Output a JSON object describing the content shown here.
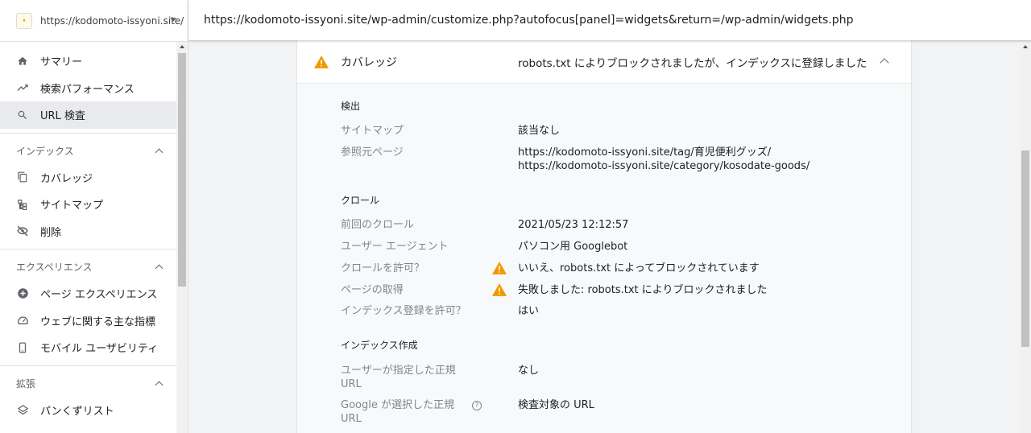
{
  "property": {
    "name": "https://kodomoto-issyoni.site/",
    "icon": "site-favicon"
  },
  "url_bar": {
    "value": "https://kodomoto-issyoni.site/wp-admin/customize.php?autofocus[panel]=widgets&return=/wp-admin/widgets.php"
  },
  "sidebar": {
    "top_items": [
      {
        "label": "サマリー",
        "icon": "home-icon"
      },
      {
        "label": "検索パフォーマンス",
        "icon": "trending-icon"
      },
      {
        "label": "URL 検査",
        "icon": "search-icon",
        "active": true
      }
    ],
    "sections": [
      {
        "title": "インデックス",
        "items": [
          {
            "label": "カバレッジ",
            "icon": "file-copy-icon"
          },
          {
            "label": "サイトマップ",
            "icon": "sitemap-icon"
          },
          {
            "label": "削除",
            "icon": "visibility-off-icon"
          }
        ]
      },
      {
        "title": "エクスペリエンス",
        "items": [
          {
            "label": "ページ エクスペリエンス",
            "icon": "add-circle-icon"
          },
          {
            "label": "ウェブに関する主な指標",
            "icon": "speed-icon"
          },
          {
            "label": "モバイル ユーザビリティ",
            "icon": "smartphone-icon"
          }
        ]
      },
      {
        "title": "拡張",
        "items": [
          {
            "label": "パンくずリスト",
            "icon": "layers-icon"
          }
        ]
      }
    ]
  },
  "card": {
    "title": "カバレッジ",
    "status": "robots.txt によりブロックされましたが、インデックスに登録しました",
    "sections": {
      "discovery": {
        "title": "検出",
        "sitemap_label": "サイトマップ",
        "sitemap_value": "該当なし",
        "referring_label": "参照元ページ",
        "referring_values": [
          "https://kodomoto-issyoni.site/tag/育児便利グッズ/",
          "https://kodomoto-issyoni.site/category/kosodate-goods/"
        ]
      },
      "crawl": {
        "title": "クロール",
        "last_crawl_label": "前回のクロール",
        "last_crawl_value": "2021/05/23 12:12:57",
        "user_agent_label": "ユーザー エージェント",
        "user_agent_value": "パソコン用 Googlebot",
        "crawl_allowed_label": "クロールを許可？",
        "crawl_allowed_value": "いいえ、robots.txt によってブロックされています",
        "page_fetch_label": "ページの取得",
        "page_fetch_value": "失敗しました: robots.txt によりブロックされました",
        "indexing_allowed_label": "インデックス登録を許可？",
        "indexing_allowed_value": "はい"
      },
      "indexing": {
        "title": "インデックス作成",
        "user_canonical_label_1": "ユーザーが指定した正規",
        "user_canonical_label_2": "URL",
        "user_canonical_value": "なし",
        "google_canonical_label_1": "Google が選択した正規",
        "google_canonical_label_2": "URL",
        "google_canonical_help": "?",
        "google_canonical_value": "検査対象の URL"
      }
    }
  },
  "colors": {
    "warning": "#f29900",
    "active_bg": "#e8eaed",
    "label_gray": "#80868b"
  }
}
